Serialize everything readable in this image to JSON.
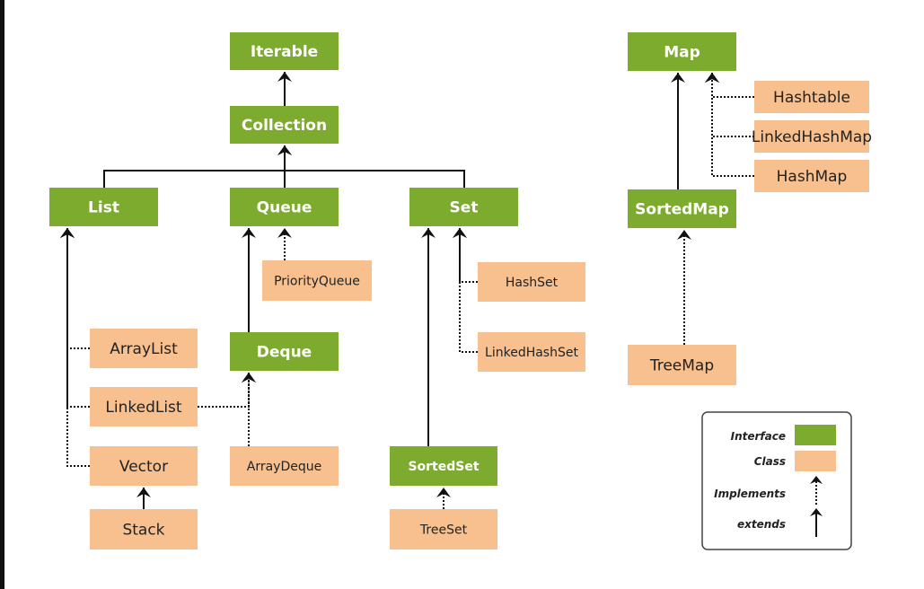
{
  "colors": {
    "interface": "#7dab2e",
    "class": "#f7c08e",
    "line": "#111111"
  },
  "nodes": [
    {
      "id": "Iterable",
      "label": "Iterable",
      "type": "interface"
    },
    {
      "id": "Collection",
      "label": "Collection",
      "type": "interface"
    },
    {
      "id": "List",
      "label": "List",
      "type": "interface"
    },
    {
      "id": "Queue",
      "label": "Queue",
      "type": "interface"
    },
    {
      "id": "Set",
      "label": "Set",
      "type": "interface"
    },
    {
      "id": "Map",
      "label": "Map",
      "type": "interface"
    },
    {
      "id": "SortedMap",
      "label": "SortedMap",
      "type": "interface"
    },
    {
      "id": "Hashtable",
      "label": "Hashtable",
      "type": "class"
    },
    {
      "id": "LinkedHashMap",
      "label": "LinkedHashMap",
      "type": "class"
    },
    {
      "id": "HashMap",
      "label": "HashMap",
      "type": "class"
    },
    {
      "id": "PriorityQueue",
      "label": "PriorityQueue",
      "type": "class"
    },
    {
      "id": "HashSet",
      "label": "HashSet",
      "type": "class"
    },
    {
      "id": "LinkedHashSet",
      "label": "LinkedHashSet",
      "type": "class"
    },
    {
      "id": "ArrayList",
      "label": "ArrayList",
      "type": "class"
    },
    {
      "id": "Deque",
      "label": "Deque",
      "type": "interface"
    },
    {
      "id": "LinkedList",
      "label": "LinkedList",
      "type": "class"
    },
    {
      "id": "Vector",
      "label": "Vector",
      "type": "class"
    },
    {
      "id": "ArrayDeque",
      "label": "ArrayDeque",
      "type": "class"
    },
    {
      "id": "SortedSet",
      "label": "SortedSet",
      "type": "interface"
    },
    {
      "id": "Stack",
      "label": "Stack",
      "type": "class"
    },
    {
      "id": "TreeSet",
      "label": "TreeSet",
      "type": "class"
    },
    {
      "id": "TreeMap",
      "label": "TreeMap",
      "type": "class"
    }
  ],
  "edges": [
    {
      "from": "Collection",
      "to": "Iterable",
      "kind": "extends"
    },
    {
      "from": "List",
      "to": "Collection",
      "kind": "extends"
    },
    {
      "from": "Queue",
      "to": "Collection",
      "kind": "extends"
    },
    {
      "from": "Set",
      "to": "Collection",
      "kind": "extends"
    },
    {
      "from": "Deque",
      "to": "Queue",
      "kind": "extends"
    },
    {
      "from": "PriorityQueue",
      "to": "Queue",
      "kind": "implements"
    },
    {
      "from": "ArrayDeque",
      "to": "Deque",
      "kind": "implements"
    },
    {
      "from": "LinkedList",
      "to": "Deque",
      "kind": "implements"
    },
    {
      "from": "ArrayList",
      "to": "List",
      "kind": "implements"
    },
    {
      "from": "LinkedList",
      "to": "List",
      "kind": "implements"
    },
    {
      "from": "Vector",
      "to": "List",
      "kind": "implements"
    },
    {
      "from": "Stack",
      "to": "Vector",
      "kind": "extends"
    },
    {
      "from": "SortedSet",
      "to": "Set",
      "kind": "extends"
    },
    {
      "from": "HashSet",
      "to": "Set",
      "kind": "implements"
    },
    {
      "from": "LinkedHashSet",
      "to": "Set",
      "kind": "implements"
    },
    {
      "from": "TreeSet",
      "to": "SortedSet",
      "kind": "implements"
    },
    {
      "from": "SortedMap",
      "to": "Map",
      "kind": "extends"
    },
    {
      "from": "Hashtable",
      "to": "Map",
      "kind": "implements"
    },
    {
      "from": "LinkedHashMap",
      "to": "Map",
      "kind": "implements"
    },
    {
      "from": "HashMap",
      "to": "Map",
      "kind": "implements"
    },
    {
      "from": "TreeMap",
      "to": "SortedMap",
      "kind": "implements"
    }
  ],
  "legend": {
    "interface": "Interface",
    "class": "Class",
    "implements": "Implements",
    "extends": "extends"
  }
}
